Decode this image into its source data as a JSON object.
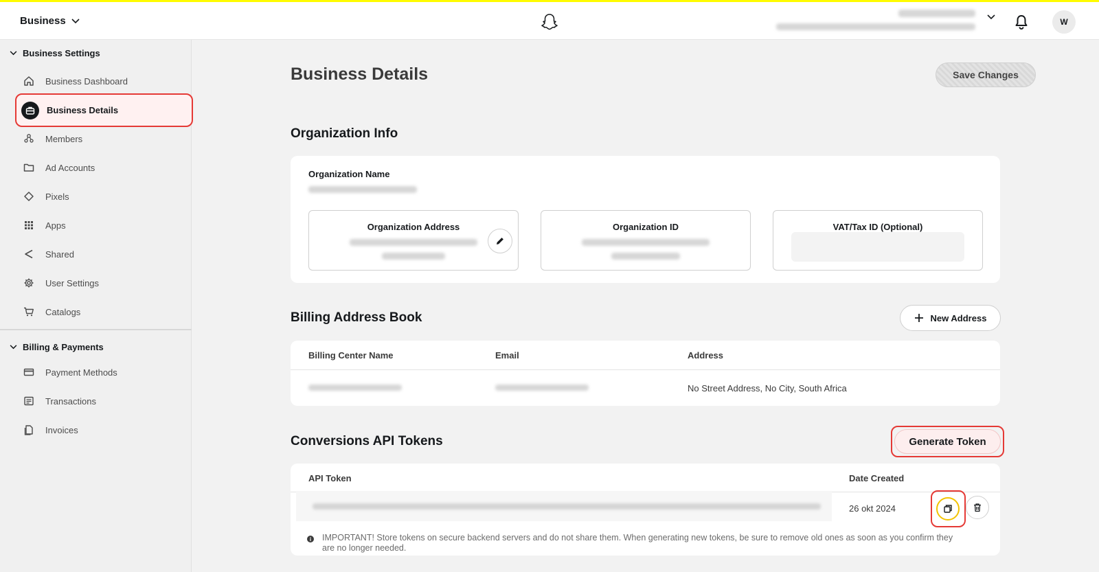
{
  "header": {
    "business_switcher_label": "Business",
    "avatar_initial": "W"
  },
  "sidebar": {
    "business_settings": {
      "title": "Business Settings",
      "items": [
        {
          "label": "Business Dashboard",
          "icon": "home-icon"
        },
        {
          "label": "Business Details",
          "icon": "briefcase-icon",
          "active": true
        },
        {
          "label": "Members",
          "icon": "members-icon"
        },
        {
          "label": "Ad Accounts",
          "icon": "folder-icon"
        },
        {
          "label": "Pixels",
          "icon": "diamond-icon"
        },
        {
          "label": "Apps",
          "icon": "grid-icon"
        },
        {
          "label": "Shared",
          "icon": "share-icon"
        },
        {
          "label": "User Settings",
          "icon": "gear-icon"
        },
        {
          "label": "Catalogs",
          "icon": "cart-icon"
        }
      ]
    },
    "billing_payments": {
      "title": "Billing & Payments",
      "items": [
        {
          "label": "Payment Methods",
          "icon": "card-icon"
        },
        {
          "label": "Transactions",
          "icon": "receipt-icon"
        },
        {
          "label": "Invoices",
          "icon": "invoice-icon"
        }
      ]
    }
  },
  "main": {
    "title": "Business Details",
    "save_button": "Save Changes",
    "org_info": {
      "title": "Organization Info",
      "name_label": "Organization Name",
      "address_label": "Organization Address",
      "id_label": "Organization ID",
      "vat_label": "VAT/Tax ID (Optional)"
    },
    "billing": {
      "title": "Billing Address Book",
      "new_address_button": "New Address",
      "columns": [
        "Billing Center Name",
        "Email",
        "Address"
      ],
      "rows": [
        {
          "address": "No Street Address, No City, South Africa"
        }
      ]
    },
    "tokens": {
      "title": "Conversions API Tokens",
      "generate_button": "Generate Token",
      "columns": [
        "API Token",
        "Date Created"
      ],
      "rows": [
        {
          "date_created": "26 okt 2024"
        }
      ],
      "note": "IMPORTANT! Store tokens on secure backend servers and do not share them. When generating new tokens, be sure to remove old ones as soon as you confirm they are no longer needed."
    }
  },
  "colors": {
    "brand_yellow": "#fffc00",
    "highlight_red": "#e53935",
    "highlight_yellow": "#f3c300"
  }
}
